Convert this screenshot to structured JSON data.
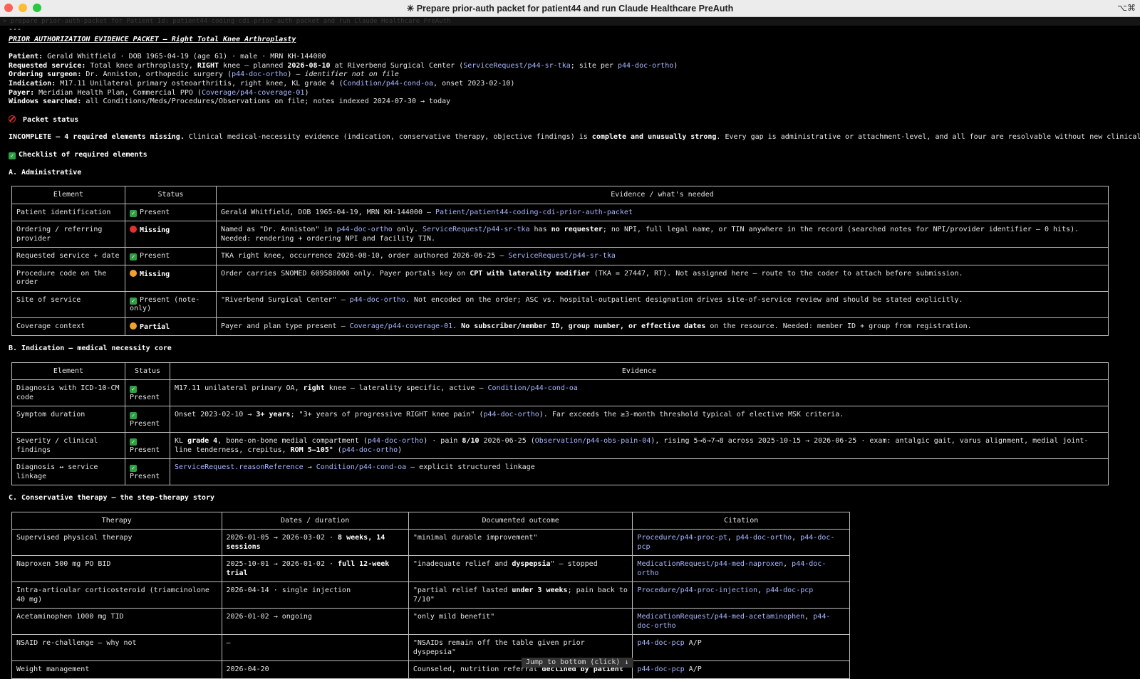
{
  "window": {
    "title": "✳ Prepare prior-auth packet for patient44 and run Claude Healthcare PreAuth",
    "right_icon": "⌥⌘"
  },
  "prompt": "> prepare prior-auth-packet for Patient Id: patient44-coding-cdi-prior-auth-packet and run Claude Healthcare PreAuth",
  "separator": "---",
  "heading": "PRIOR AUTHORIZATION EVIDENCE PACKET — Right Total Knee Arthroplasty",
  "meta": {
    "patient": {
      "label": "Patient:",
      "text": "Gerald Whitfield · DOB 1965-04-19 (age 61) · male · MRN KH-144000"
    },
    "service": {
      "label": "Requested service:",
      "t1": "Total knee arthroplasty, ",
      "bold1": "RIGHT",
      "t2": " knee — planned ",
      "bold2": "2026-08-10",
      "t3": " at Riverbend Surgical Center (",
      "link1": "ServiceRequest/p44-sr-tka",
      "t4": "; site per ",
      "link2": "p44-doc-ortho",
      "t5": ")"
    },
    "surgeon": {
      "label": "Ordering surgeon:",
      "t1": "Dr. Anniston, orthopedic surgery (",
      "link": "p44-doc-ortho",
      "t2": ") — ",
      "italic": "identifier not on file"
    },
    "indication": {
      "label": "Indication:",
      "t1": "M17.11 Unilateral primary osteoarthritis, right knee, KL grade 4 (",
      "link": "Condition/p44-cond-oa",
      "t2": ", onset 2023-02-10)"
    },
    "payer": {
      "label": "Payer:",
      "t1": "Meridian Health Plan, Commercial PPO (",
      "link": "Coverage/p44-coverage-01",
      "t2": ")"
    },
    "windows": {
      "label": "Windows searched:",
      "text": "all Conditions/Meds/Procedures/Observations on file; notes indexed 2024-07-30 → today"
    }
  },
  "packet_status": {
    "heading": "Packet status",
    "bold1": "INCOMPLETE — 4 required elements missing.",
    "t1": " Clinical medical-necessity evidence (indication, conservative therapy, objective findings) is ",
    "bold2": "complete and unusually strong",
    "t2": ". Every gap is administrative or attachment-level, and all four are resolvable without new clinical work."
  },
  "checklist_heading": "Checklist of required elements",
  "section_a": {
    "heading": "A. Administrative",
    "headers": [
      "Element",
      "Status",
      "Evidence / what's needed"
    ],
    "rows": [
      {
        "element": "Patient identification",
        "status": "Present",
        "icon": "check",
        "ev": [
          {
            "t": "Gerald Whitfield, DOB 1965-04-19, MRN KH-144000 — "
          },
          {
            "l": "Patient/patient44-coding-cdi-prior-auth-packet"
          }
        ]
      },
      {
        "element": "Ordering / referring provider",
        "status": "Missing",
        "icon": "red",
        "ev": [
          {
            "t": "Named as \"Dr. Anniston\" in "
          },
          {
            "l": "p44-doc-ortho"
          },
          {
            "t": " only. "
          },
          {
            "l": "ServiceRequest/p44-sr-tka"
          },
          {
            "t": " has "
          },
          {
            "b": "no requester"
          },
          {
            "t": "; no NPI, full legal name, or TIN anywhere in the record (searched notes for NPI/provider identifier — 0 hits). Needed: rendering + ordering NPI and facility TIN."
          }
        ]
      },
      {
        "element": "Requested service + date",
        "status": "Present",
        "icon": "check",
        "ev": [
          {
            "t": "TKA right knee, occurrence 2026-08-10, order authored 2026-06-25 — "
          },
          {
            "l": "ServiceRequest/p44-sr-tka"
          }
        ]
      },
      {
        "element": "Procedure code on the order",
        "status": "Missing",
        "icon": "orange",
        "ev": [
          {
            "t": "Order carries SNOMED 609588000 only. Payer portals key on "
          },
          {
            "b": "CPT with laterality modifier"
          },
          {
            "t": " (TKA = 27447, RT). Not assigned here — route to the coder to attach before submission."
          }
        ]
      },
      {
        "element": "Site of service",
        "status": "Present (note-only)",
        "icon": "check",
        "ev": [
          {
            "t": "\"Riverbend Surgical Center\" — "
          },
          {
            "l": "p44-doc-ortho"
          },
          {
            "t": ". Not encoded on the order; ASC vs. hospital-outpatient designation drives site-of-service review and should be stated explicitly."
          }
        ]
      },
      {
        "element": "Coverage context",
        "status": "Partial",
        "icon": "orange",
        "ev": [
          {
            "t": "Payer and plan type present — "
          },
          {
            "l": "Coverage/p44-coverage-01"
          },
          {
            "t": ". "
          },
          {
            "b": "No subscriber/member ID, group number, or effective dates"
          },
          {
            "t": " on the resource. Needed: member ID + group from registration."
          }
        ]
      }
    ]
  },
  "section_b": {
    "heading": "B. Indication — medical necessity core",
    "headers": [
      "Element",
      "Status",
      "Evidence"
    ],
    "rows": [
      {
        "element": "Diagnosis with ICD-10-CM code",
        "status": "Present",
        "ev": [
          {
            "t": "M17.11 unilateral primary OA, "
          },
          {
            "b": "right"
          },
          {
            "t": " knee — laterality specific, active — "
          },
          {
            "l": "Condition/p44-cond-oa"
          }
        ]
      },
      {
        "element": "Symptom duration",
        "status": "Present",
        "ev": [
          {
            "t": "Onset 2023-02-10 → "
          },
          {
            "b": "3+ years"
          },
          {
            "t": "; \"3+ years of progressive RIGHT knee pain\" ("
          },
          {
            "l": "p44-doc-ortho"
          },
          {
            "t": "). Far exceeds the ≥3-month threshold typical of elective MSK criteria."
          }
        ]
      },
      {
        "element": "Severity / clinical findings",
        "status": "Present",
        "ev": [
          {
            "t": "KL "
          },
          {
            "b": "grade 4"
          },
          {
            "t": ", bone-on-bone medial compartment ("
          },
          {
            "l": "p44-doc-ortho"
          },
          {
            "t": ") · pain "
          },
          {
            "b": "8/10"
          },
          {
            "t": " 2026-06-25 ("
          },
          {
            "l": "Observation/p44-obs-pain-04"
          },
          {
            "t": "), rising 5→6→7→8 across 2025-10-15 → 2026-06-25 · exam: antalgic gait, varus alignment, medial joint-line tenderness, crepitus, "
          },
          {
            "b": "ROM 5–105°"
          },
          {
            "t": " ("
          },
          {
            "l": "p44-doc-ortho"
          },
          {
            "t": ")"
          }
        ]
      },
      {
        "element": "Diagnosis ↔ service linkage",
        "status": "Present",
        "ev": [
          {
            "l": "ServiceRequest.reasonReference"
          },
          {
            "t": " → "
          },
          {
            "l": "Condition/p44-cond-oa"
          },
          {
            "t": " — explicit structured linkage"
          }
        ]
      }
    ]
  },
  "section_c": {
    "heading": "C. Conservative therapy — the step-therapy story",
    "headers": [
      "Therapy",
      "Dates / duration",
      "Documented outcome",
      "Citation"
    ],
    "rows": [
      {
        "therapy": "Supervised physical therapy",
        "dates": [
          {
            "t": "2026-01-05 → 2026-03-02 · "
          },
          {
            "b": "8 weeks, 14 sessions"
          }
        ],
        "outcome": [
          {
            "t": "\"minimal durable improvement\""
          }
        ],
        "cite": [
          {
            "l": "Procedure/p44-proc-pt"
          },
          {
            "t": ", "
          },
          {
            "l": "p44-doc-ortho"
          },
          {
            "t": ", "
          },
          {
            "l": "p44-doc-pcp"
          }
        ]
      },
      {
        "therapy": "Naproxen 500 mg PO BID",
        "dates": [
          {
            "t": "2025-10-01 → 2026-01-02 · "
          },
          {
            "b": "full 12-week trial"
          }
        ],
        "outcome": [
          {
            "t": "\"inadequate relief and "
          },
          {
            "b": "dyspepsia"
          },
          {
            "t": "\" — stopped"
          }
        ],
        "cite": [
          {
            "l": "MedicationRequest/p44-med-naproxen"
          },
          {
            "t": ", "
          },
          {
            "l": "p44-doc-ortho"
          }
        ]
      },
      {
        "therapy": "Intra-articular corticosteroid (triamcinolone 40 mg)",
        "dates": [
          {
            "t": "2026-04-14 · single injection"
          }
        ],
        "outcome": [
          {
            "t": "\"partial relief lasted "
          },
          {
            "b": "under 3 weeks"
          },
          {
            "t": "; pain back to 7/10\""
          }
        ],
        "cite": [
          {
            "l": "Procedure/p44-proc-injection"
          },
          {
            "t": ", "
          },
          {
            "l": "p44-doc-pcp"
          }
        ]
      },
      {
        "therapy": "Acetaminophen 1000 mg TID",
        "dates": [
          {
            "t": "2026-01-02 → ongoing"
          }
        ],
        "outcome": [
          {
            "t": "\"only mild benefit\""
          }
        ],
        "cite": [
          {
            "l": "MedicationRequest/p44-med-acetaminophen"
          },
          {
            "t": ", "
          },
          {
            "l": "p44-doc-ortho"
          }
        ]
      },
      {
        "therapy": "NSAID re-challenge — why not",
        "dates": [
          {
            "t": "—"
          }
        ],
        "outcome": [
          {
            "t": "\"NSAIDs remain off the table given prior dyspepsia\""
          }
        ],
        "cite": [
          {
            "l": "p44-doc-pcp"
          },
          {
            "t": " A/P"
          }
        ]
      },
      {
        "therapy": "Weight management",
        "dates": [
          {
            "t": "2026-04-20"
          }
        ],
        "outcome": [
          {
            "t": "Counseled, nutrition referral "
          },
          {
            "b": "declined by patient"
          }
        ],
        "cite": [
          {
            "l": "p44-doc-pcp"
          },
          {
            "t": " A/P"
          }
        ]
      }
    ]
  },
  "jump_button": "Jump to bottom (click) ↓"
}
